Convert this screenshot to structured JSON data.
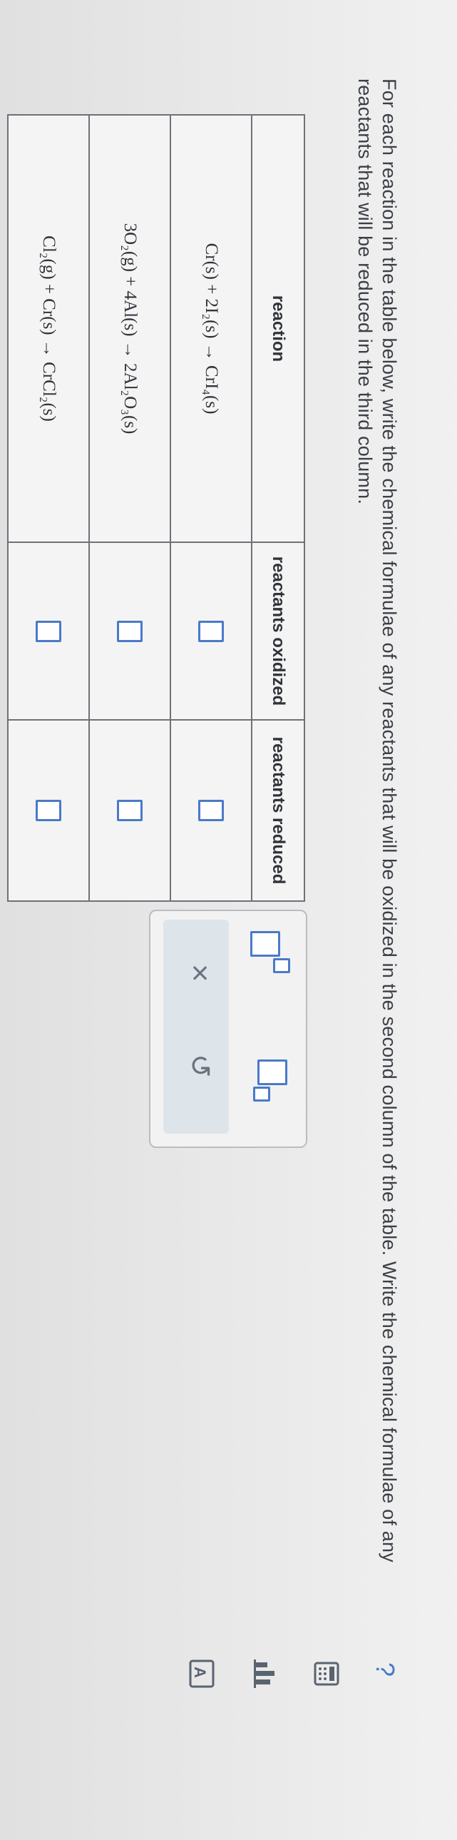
{
  "instructions": "For each reaction in the table below, write the chemical formulae of any reactants that will be oxidized in the second column of the table. Write the chemical formulae of any reactants that will be reduced in the third column.",
  "table": {
    "headers": {
      "reaction": "reaction",
      "oxidized": "reactants oxidized",
      "reduced": "reactants reduced"
    },
    "rows": [
      {
        "reaction": "Cr(s) + 2I₂(s) → CrI₄(s)",
        "oxidized": "",
        "reduced": ""
      },
      {
        "reaction": "3O₂(g) + 4Al(s) → 2Al₂O₃(s)",
        "oxidized": "",
        "reduced": ""
      },
      {
        "reaction": "Cl₂(g) + Cr(s) → CrCl₂(s)",
        "oxidized": "",
        "reduced": ""
      }
    ]
  },
  "tool_palette": {
    "superscript_button": "superscript-template",
    "subscript_button": "subscript-template",
    "clear_label": "×",
    "undo_label": "↺"
  },
  "side_icons": {
    "help": "?",
    "calculator": "calculator-icon",
    "chart": "chart-icon",
    "text_size": "text-size-icon"
  }
}
